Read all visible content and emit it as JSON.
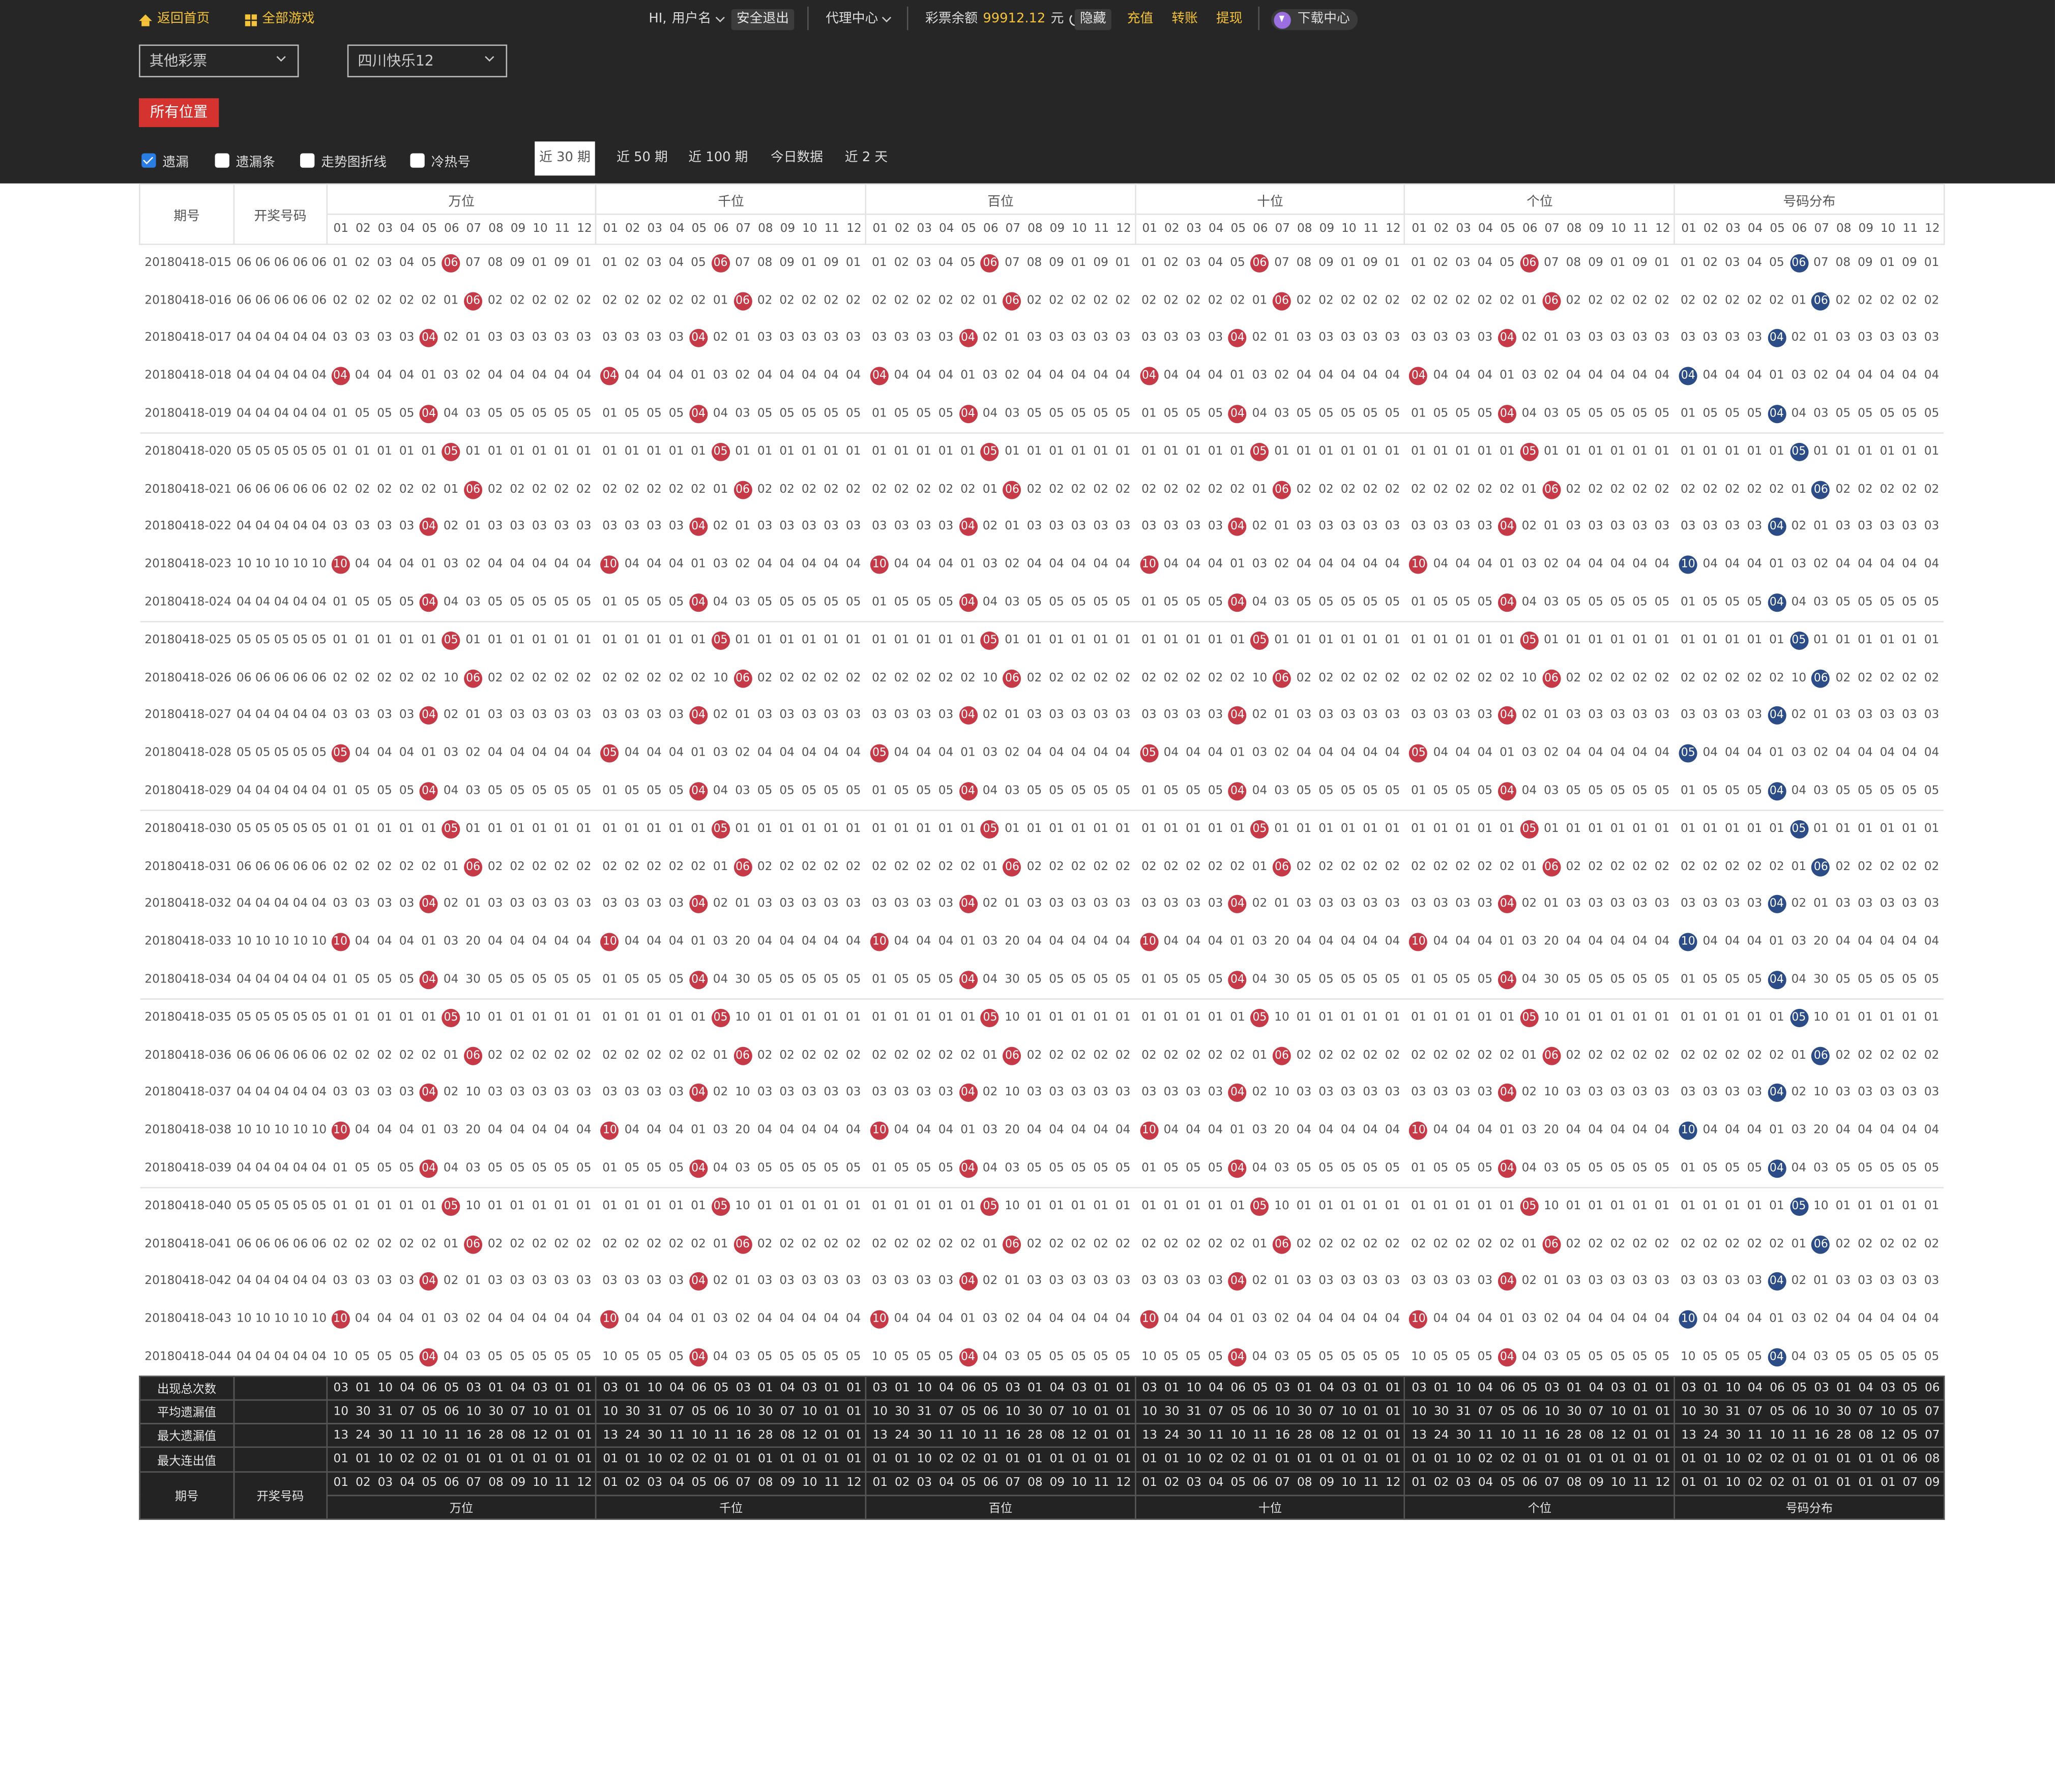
{
  "header": {
    "home": "返回首页",
    "all_games": "全部游戏",
    "greeting": "HI,",
    "username": "用户名",
    "logout": "安全退出",
    "agent": "代理中心",
    "balance_label": "彩票余额",
    "balance": "99912.12",
    "balance_unit": "元",
    "hide": "隐藏",
    "recharge": "充值",
    "transfer": "转账",
    "withdraw": "提现",
    "download": "下载中心"
  },
  "filters": {
    "category": "其他彩票",
    "game": "四川快乐12",
    "position_btn": "所有位置",
    "checkboxes": [
      {
        "label": "遗漏",
        "checked": true
      },
      {
        "label": "遗漏条",
        "checked": false
      },
      {
        "label": "走势图折线",
        "checked": false
      },
      {
        "label": "冷热号",
        "checked": false
      }
    ],
    "ranges": [
      "近 30 期",
      "近 50 期",
      "近 100 期",
      "今日数据",
      "近 2 天"
    ],
    "active_range": "近 30 期"
  },
  "table": {
    "col_issue": "期号",
    "col_draw": "开奖号码",
    "groups": [
      "万位",
      "千位",
      "百位",
      "十位",
      "个位",
      "号码分布"
    ],
    "nums": [
      "01",
      "02",
      "03",
      "04",
      "05",
      "06",
      "07",
      "08",
      "09",
      "10",
      "11",
      "12"
    ],
    "rows": [
      {
        "issue": "20180418-015",
        "draw": "06 06 06 06 06",
        "vals": [
          "01",
          "02",
          "03",
          "04",
          "05",
          "06",
          "07",
          "08",
          "09",
          "01",
          "09",
          "01"
        ],
        "hit": 5
      },
      {
        "issue": "20180418-016",
        "draw": "06 06 06 06 06",
        "vals": [
          "02",
          "02",
          "02",
          "02",
          "02",
          "01",
          "06",
          "02",
          "02",
          "02",
          "02",
          "02"
        ],
        "hit": 6
      },
      {
        "issue": "20180418-017",
        "draw": "04 04 04 04 04",
        "vals": [
          "03",
          "03",
          "03",
          "03",
          "04",
          "02",
          "01",
          "03",
          "03",
          "03",
          "03",
          "03"
        ],
        "hit": 4
      },
      {
        "issue": "20180418-018",
        "draw": "04 04 04 04 04",
        "vals": [
          "04",
          "04",
          "04",
          "04",
          "01",
          "03",
          "02",
          "04",
          "04",
          "04",
          "04",
          "04"
        ],
        "hit": 0
      },
      {
        "issue": "20180418-019",
        "draw": "04 04 04 04 04",
        "vals": [
          "01",
          "05",
          "05",
          "05",
          "04",
          "04",
          "03",
          "05",
          "05",
          "05",
          "05",
          "05"
        ],
        "hit": 4
      },
      {
        "issue": "20180418-020",
        "draw": "05 05 05 05 05",
        "vals": [
          "01",
          "01",
          "01",
          "01",
          "01",
          "05",
          "01",
          "01",
          "01",
          "01",
          "01",
          "01"
        ],
        "hit": 5
      },
      {
        "issue": "20180418-021",
        "draw": "06 06 06 06 06",
        "vals": [
          "02",
          "02",
          "02",
          "02",
          "02",
          "01",
          "06",
          "02",
          "02",
          "02",
          "02",
          "02"
        ],
        "hit": 6
      },
      {
        "issue": "20180418-022",
        "draw": "04 04 04 04 04",
        "vals": [
          "03",
          "03",
          "03",
          "03",
          "04",
          "02",
          "01",
          "03",
          "03",
          "03",
          "03",
          "03"
        ],
        "hit": 4
      },
      {
        "issue": "20180418-023",
        "draw": "10 10 10 10 10",
        "vals": [
          "10",
          "04",
          "04",
          "04",
          "01",
          "03",
          "02",
          "04",
          "04",
          "04",
          "04",
          "04"
        ],
        "hit": 0
      },
      {
        "issue": "20180418-024",
        "draw": "04 04 04 04 04",
        "vals": [
          "01",
          "05",
          "05",
          "05",
          "04",
          "04",
          "03",
          "05",
          "05",
          "05",
          "05",
          "05"
        ],
        "hit": 4
      },
      {
        "issue": "20180418-025",
        "draw": "05 05 05 05 05",
        "vals": [
          "01",
          "01",
          "01",
          "01",
          "01",
          "05",
          "01",
          "01",
          "01",
          "01",
          "01",
          "01"
        ],
        "hit": 5
      },
      {
        "issue": "20180418-026",
        "draw": "06 06 06 06 06",
        "vals": [
          "02",
          "02",
          "02",
          "02",
          "02",
          "10",
          "06",
          "02",
          "02",
          "02",
          "02",
          "02"
        ],
        "hit": 6
      },
      {
        "issue": "20180418-027",
        "draw": "04 04 04 04 04",
        "vals": [
          "03",
          "03",
          "03",
          "03",
          "04",
          "02",
          "01",
          "03",
          "03",
          "03",
          "03",
          "03"
        ],
        "hit": 4
      },
      {
        "issue": "20180418-028",
        "draw": "05 05 05 05 05",
        "vals": [
          "05",
          "04",
          "04",
          "04",
          "01",
          "03",
          "02",
          "04",
          "04",
          "04",
          "04",
          "04"
        ],
        "hit": 0
      },
      {
        "issue": "20180418-029",
        "draw": "04 04 04 04 04",
        "vals": [
          "01",
          "05",
          "05",
          "05",
          "04",
          "04",
          "03",
          "05",
          "05",
          "05",
          "05",
          "05"
        ],
        "hit": 4
      },
      {
        "issue": "20180418-030",
        "draw": "05 05 05 05 05",
        "vals": [
          "01",
          "01",
          "01",
          "01",
          "01",
          "05",
          "01",
          "01",
          "01",
          "01",
          "01",
          "01"
        ],
        "hit": 5
      },
      {
        "issue": "20180418-031",
        "draw": "06 06 06 06 06",
        "vals": [
          "02",
          "02",
          "02",
          "02",
          "02",
          "01",
          "06",
          "02",
          "02",
          "02",
          "02",
          "02"
        ],
        "hit": 6
      },
      {
        "issue": "20180418-032",
        "draw": "04 04 04 04 04",
        "vals": [
          "03",
          "03",
          "03",
          "03",
          "04",
          "02",
          "01",
          "03",
          "03",
          "03",
          "03",
          "03"
        ],
        "hit": 4
      },
      {
        "issue": "20180418-033",
        "draw": "10 10 10 10 10",
        "vals": [
          "10",
          "04",
          "04",
          "04",
          "01",
          "03",
          "20",
          "04",
          "04",
          "04",
          "04",
          "04"
        ],
        "hit": 0
      },
      {
        "issue": "20180418-034",
        "draw": "04 04 04 04 04",
        "vals": [
          "01",
          "05",
          "05",
          "05",
          "04",
          "04",
          "30",
          "05",
          "05",
          "05",
          "05",
          "05"
        ],
        "hit": 4
      },
      {
        "issue": "20180418-035",
        "draw": "05 05 05 05 05",
        "vals": [
          "01",
          "01",
          "01",
          "01",
          "01",
          "05",
          "10",
          "01",
          "01",
          "01",
          "01",
          "01"
        ],
        "hit": 5
      },
      {
        "issue": "20180418-036",
        "draw": "06 06 06 06 06",
        "vals": [
          "02",
          "02",
          "02",
          "02",
          "02",
          "01",
          "06",
          "02",
          "02",
          "02",
          "02",
          "02"
        ],
        "hit": 6
      },
      {
        "issue": "20180418-037",
        "draw": "04 04 04 04 04",
        "vals": [
          "03",
          "03",
          "03",
          "03",
          "04",
          "02",
          "10",
          "03",
          "03",
          "03",
          "03",
          "03"
        ],
        "hit": 4
      },
      {
        "issue": "20180418-038",
        "draw": "10 10 10 10 10",
        "vals": [
          "10",
          "04",
          "04",
          "04",
          "01",
          "03",
          "20",
          "04",
          "04",
          "04",
          "04",
          "04"
        ],
        "hit": 0
      },
      {
        "issue": "20180418-039",
        "draw": "04 04 04 04 04",
        "vals": [
          "01",
          "05",
          "05",
          "05",
          "04",
          "04",
          "03",
          "05",
          "05",
          "05",
          "05",
          "05"
        ],
        "hit": 4
      },
      {
        "issue": "20180418-040",
        "draw": "05 05 05 05 05",
        "vals": [
          "01",
          "01",
          "01",
          "01",
          "01",
          "05",
          "10",
          "01",
          "01",
          "01",
          "01",
          "01"
        ],
        "hit": 5
      },
      {
        "issue": "20180418-041",
        "draw": "06 06 06 06 06",
        "vals": [
          "02",
          "02",
          "02",
          "02",
          "02",
          "01",
          "06",
          "02",
          "02",
          "02",
          "02",
          "02"
        ],
        "hit": 6
      },
      {
        "issue": "20180418-042",
        "draw": "04 04 04 04 04",
        "vals": [
          "03",
          "03",
          "03",
          "03",
          "04",
          "02",
          "01",
          "03",
          "03",
          "03",
          "03",
          "03"
        ],
        "hit": 4
      },
      {
        "issue": "20180418-043",
        "draw": "10 10 10 10 10",
        "vals": [
          "10",
          "04",
          "04",
          "04",
          "01",
          "03",
          "02",
          "04",
          "04",
          "04",
          "04",
          "04"
        ],
        "hit": 0
      },
      {
        "issue": "20180418-044",
        "draw": "04 04 04 04 04",
        "vals": [
          "10",
          "05",
          "05",
          "05",
          "04",
          "04",
          "03",
          "05",
          "05",
          "05",
          "05",
          "05"
        ],
        "hit": 4
      }
    ],
    "stats": [
      {
        "label": "出现总次数",
        "vals": [
          "03",
          "01",
          "10",
          "04",
          "06",
          "05",
          "03",
          "01",
          "04",
          "03",
          "01",
          "01"
        ],
        "last": [
          "03",
          "01",
          "10",
          "04",
          "06",
          "05",
          "03",
          "01",
          "04",
          "03",
          "05",
          "06"
        ]
      },
      {
        "label": "平均遗漏值",
        "vals": [
          "10",
          "30",
          "31",
          "07",
          "05",
          "06",
          "10",
          "30",
          "07",
          "10",
          "01",
          "01"
        ],
        "last": [
          "10",
          "30",
          "31",
          "07",
          "05",
          "06",
          "10",
          "30",
          "07",
          "10",
          "05",
          "07"
        ]
      },
      {
        "label": "最大遗漏值",
        "vals": [
          "13",
          "24",
          "30",
          "11",
          "10",
          "11",
          "16",
          "28",
          "08",
          "12",
          "01",
          "01"
        ],
        "last": [
          "13",
          "24",
          "30",
          "11",
          "10",
          "11",
          "16",
          "28",
          "08",
          "12",
          "05",
          "07"
        ]
      },
      {
        "label": "最大连出值",
        "vals": [
          "01",
          "01",
          "10",
          "02",
          "02",
          "01",
          "01",
          "01",
          "01",
          "01",
          "01",
          "01"
        ],
        "last": [
          "01",
          "01",
          "10",
          "02",
          "02",
          "01",
          "01",
          "01",
          "01",
          "01",
          "06",
          "08"
        ]
      }
    ],
    "foot_nums": [
      "01",
      "02",
      "03",
      "04",
      "05",
      "06",
      "07",
      "08",
      "09",
      "10",
      "11",
      "12"
    ],
    "foot_nums_last": [
      "01",
      "01",
      "10",
      "02",
      "02",
      "01",
      "01",
      "01",
      "01",
      "01",
      "07",
      "09"
    ]
  }
}
